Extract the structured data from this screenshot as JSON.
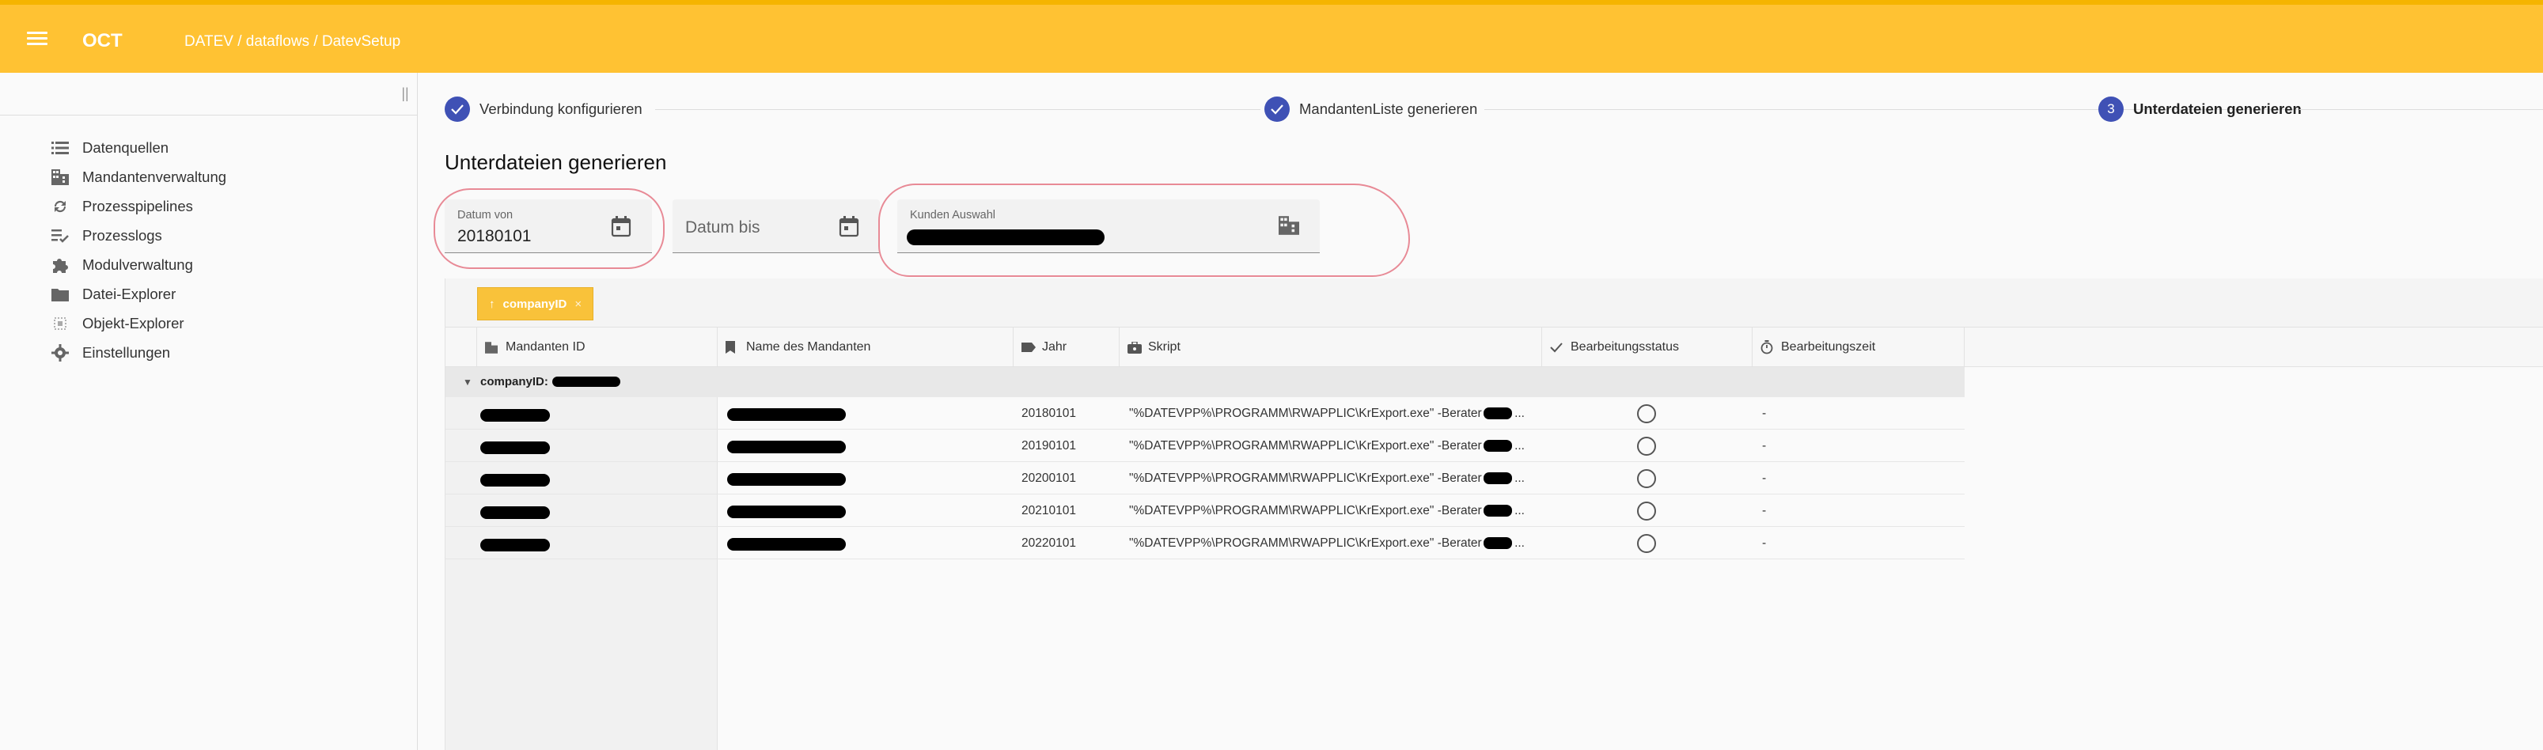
{
  "topbar": {
    "app_title": "OCT",
    "breadcrumb": "DATEV / dataflows / DatevSetup",
    "color": "#ffc233"
  },
  "sidebar": {
    "items": [
      {
        "label": "Datenquellen",
        "icon": "list-icon"
      },
      {
        "label": "Mandantenverwaltung",
        "icon": "building-icon"
      },
      {
        "label": "Prozesspipelines",
        "icon": "sync-icon"
      },
      {
        "label": "Prozesslogs",
        "icon": "checklist-icon"
      },
      {
        "label": "Modulverwaltung",
        "icon": "puzzle-icon"
      },
      {
        "label": "Datei-Explorer",
        "icon": "folder-icon"
      },
      {
        "label": "Objekt-Explorer",
        "icon": "object-icon"
      },
      {
        "label": "Einstellungen",
        "icon": "gear-icon"
      }
    ]
  },
  "stepper": {
    "steps": [
      {
        "label": "Verbindung konfigurieren",
        "state": "done"
      },
      {
        "label": "MandantenListe generieren",
        "state": "done"
      },
      {
        "label": "Unterdateien generieren",
        "state": "active",
        "number": "3"
      }
    ],
    "accent": "#3f51b5"
  },
  "section_title": "Unterdateien generieren",
  "filters": {
    "datum_von": {
      "label": "Datum von",
      "value": "20180101"
    },
    "datum_bis": {
      "placeholder": "Datum bis"
    },
    "kunden": {
      "label": "Kunden Auswahl"
    }
  },
  "grid": {
    "group_chip": "companyID",
    "columns": [
      {
        "label": "Mandanten ID",
        "icon": "building-icon"
      },
      {
        "label": "Name des Mandanten",
        "icon": "bookmark-icon"
      },
      {
        "label": "Jahr",
        "icon": "tag-icon"
      },
      {
        "label": "Skript",
        "icon": "briefcase-icon"
      },
      {
        "label": "Bearbeitungsstatus",
        "icon": "check-icon"
      },
      {
        "label": "Bearbeitungszeit",
        "icon": "timer-icon"
      }
    ],
    "group_label": "companyID:",
    "rows": [
      {
        "jahr": "20180101",
        "skript_pre": "\"%DATEVPP%\\PROGRAMM\\RWAPPLIC\\KrExport.exe\" -Berater",
        "skript_post": "3 ...",
        "zeit": "-"
      },
      {
        "jahr": "20190101",
        "skript_pre": "\"%DATEVPP%\\PROGRAMM\\RWAPPLIC\\KrExport.exe\" -Berater",
        "skript_post": "3 ...",
        "zeit": "-"
      },
      {
        "jahr": "20200101",
        "skript_pre": "\"%DATEVPP%\\PROGRAMM\\RWAPPLIC\\KrExport.exe\" -Berater",
        "skript_post": "3 ...",
        "zeit": "-"
      },
      {
        "jahr": "20210101",
        "skript_pre": "\"%DATEVPP%\\PROGRAMM\\RWAPPLIC\\KrExport.exe\" -Berater",
        "skript_post": "3 ...",
        "zeit": "-"
      },
      {
        "jahr": "20220101",
        "skript_pre": "\"%DATEVPP%\\PROGRAMM\\RWAPPLIC\\KrExport.exe\" -Berater",
        "skript_post": "3 ...",
        "zeit": "-"
      }
    ]
  }
}
